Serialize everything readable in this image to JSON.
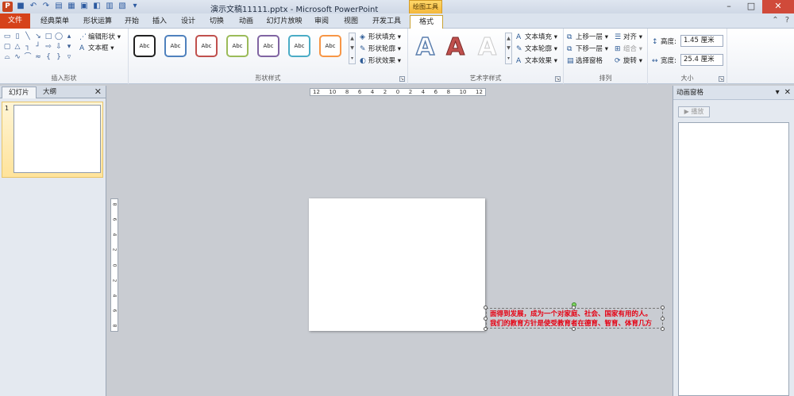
{
  "window": {
    "app_icon": "P",
    "title": "演示文稿11111.pptx - Microsoft PowerPoint",
    "context_tool": "绘图工具",
    "controls": [
      "–",
      "□",
      "✕"
    ]
  },
  "tabs": [
    "文件",
    "经典菜单",
    "形状运算",
    "开始",
    "插入",
    "设计",
    "切换",
    "动画",
    "幻灯片放映",
    "审阅",
    "视图",
    "开发工具",
    "格式"
  ],
  "active_tab": "格式",
  "ribbon": {
    "insert_shapes": {
      "label": "插入形状",
      "edit_shape": "编辑形状",
      "text_box": "文本框"
    },
    "shape_styles": {
      "label": "形状样式",
      "style_sample": "Abc",
      "fill": "形状填充",
      "outline": "形状轮廓",
      "effects": "形状效果",
      "style_colors": [
        "#222222",
        "#4f81bd",
        "#c0504d",
        "#9bbb59",
        "#8064a2",
        "#4bacc6",
        "#f79646"
      ]
    },
    "wordart": {
      "label": "艺术字样式",
      "glyph": "A",
      "text_fill": "文本填充",
      "text_outline": "文本轮廓",
      "text_effects": "文本效果"
    },
    "arrange": {
      "label": "排列",
      "bring_forward": "上移一层",
      "send_backward": "下移一层",
      "selection_pane": "选择窗格",
      "align": "对齐",
      "group": "组合",
      "rotate": "旋转"
    },
    "size": {
      "label": "大小",
      "height_label": "高度:",
      "height_value": "1.45 厘米",
      "width_label": "宽度:",
      "width_value": "25.4 厘米"
    }
  },
  "left_pane": {
    "tab_slides": "幻灯片",
    "tab_outline": "大纲",
    "slide_number": "1"
  },
  "ruler": {
    "h_ticks": [
      "12",
      "10",
      "8",
      "6",
      "4",
      "2",
      "0",
      "2",
      "4",
      "6",
      "8",
      "10",
      "12"
    ],
    "v_ticks": [
      "8",
      "6",
      "4",
      "2",
      "0",
      "2",
      "4",
      "6",
      "8"
    ]
  },
  "textbox": {
    "line1": "面得到发展，成为一个对家庭、社会、国家有用的人。",
    "line2": "我们的教育方针是使受教育者在德育、智育、体育几方"
  },
  "animation_pane": {
    "title": "动画窗格",
    "play": "▶ 播放"
  },
  "colors": {
    "file_tab": "#d6421a",
    "textbox_text": "#e60012"
  }
}
